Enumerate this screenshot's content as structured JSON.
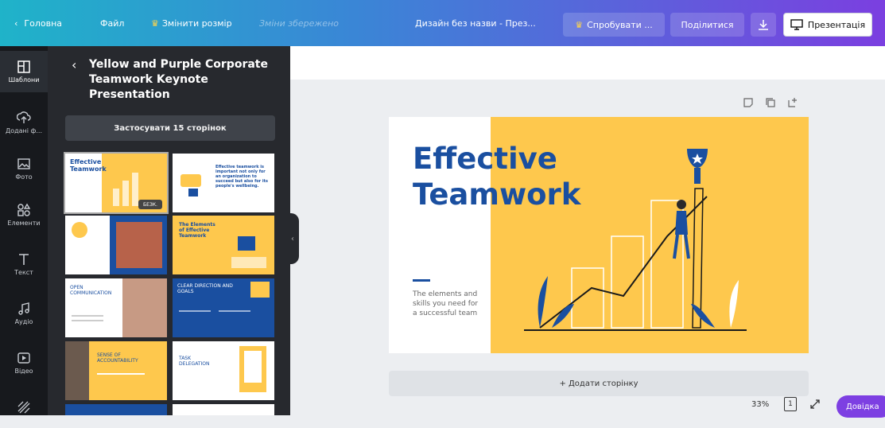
{
  "topbar": {
    "home": "Головна",
    "file": "Файл",
    "resize": "Змінити розмір",
    "saved": "Зміни збережено",
    "design_title": "Дизайн без назви - През...",
    "try_pro": "Спробувати ...",
    "share": "Поділитися",
    "present": "Презентація"
  },
  "rail": [
    {
      "label": "Шаблони",
      "icon": "templates-icon"
    },
    {
      "label": "Додані ф...",
      "icon": "upload-icon"
    },
    {
      "label": "Фото",
      "icon": "photo-icon"
    },
    {
      "label": "Елементи",
      "icon": "elements-icon"
    },
    {
      "label": "Текст",
      "icon": "text-icon"
    },
    {
      "label": "Аудіо",
      "icon": "audio-icon"
    },
    {
      "label": "Відео",
      "icon": "video-icon"
    },
    {
      "label": "",
      "icon": "pattern-icon"
    }
  ],
  "panel": {
    "title": "Yellow and Purple Corporate Teamwork Keynote Presentation",
    "apply": "Застосувати 15 сторінок",
    "free_badge": "БЕЗК.",
    "thumbs": {
      "t1": "Effective Teamwork",
      "t2": "Effective teamwork is important not only for an organization to succeed but also for its people's wellbeing.",
      "t4": "The Elements of Effective Teamwork",
      "t5": "OPEN COMMUNICATION",
      "t6": "CLEAR DIRECTION AND GOALS",
      "t7": "SENSE OF ACCOUNTABILITY",
      "t8": "TASK DELEGATION"
    }
  },
  "slide": {
    "title_line1": "Effective",
    "title_line2": "Teamwork",
    "subtitle": "The elements and skills you need for a successful team"
  },
  "canvas": {
    "add_page": "+ Додати сторінку",
    "zoom": "33%",
    "page_number": "1"
  },
  "help": "Довідка",
  "colors": {
    "accent": "#7d3fe2",
    "slide_yellow": "#fec84d",
    "slide_blue": "#1a4fa0"
  }
}
